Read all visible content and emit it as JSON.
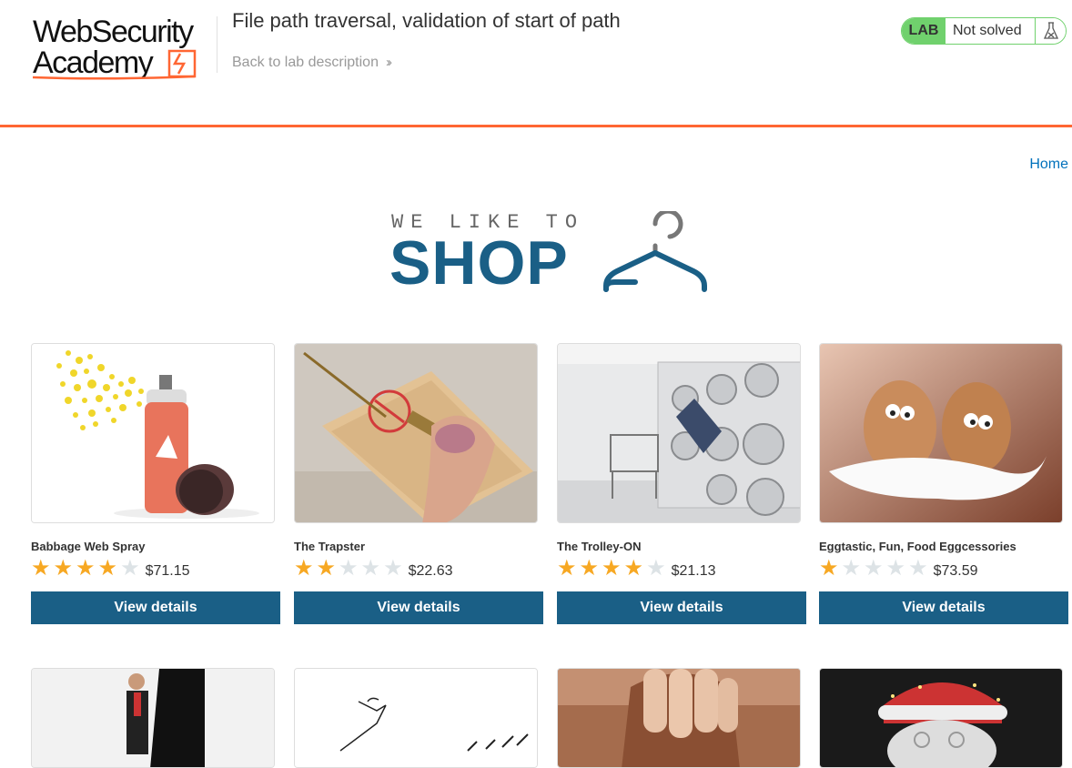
{
  "header": {
    "logo_line1": "WebSecurity",
    "logo_line2": "Academy",
    "lab_title": "File path traversal, validation of start of path",
    "back_link": "Back to lab description",
    "status": {
      "badge": "LAB",
      "text": "Not solved"
    }
  },
  "nav": {
    "home": "Home"
  },
  "banner": {
    "sub": "WE LIKE TO",
    "main": "SHOP"
  },
  "products": [
    {
      "name": "Babbage Web Spray",
      "rating": 4,
      "price": "$71.15",
      "button": "View details"
    },
    {
      "name": "The Trapster",
      "rating": 2,
      "price": "$22.63",
      "button": "View details"
    },
    {
      "name": "The Trolley-ON",
      "rating": 4,
      "price": "$21.13",
      "button": "View details"
    },
    {
      "name": "Eggtastic, Fun, Food Eggcessories",
      "rating": 1,
      "price": "$73.59",
      "button": "View details"
    }
  ],
  "colors": {
    "accent": "#ff6633",
    "button": "#1a5f86",
    "star": "#f7a823",
    "lab_green": "#70d16d",
    "link": "#0071bc"
  }
}
